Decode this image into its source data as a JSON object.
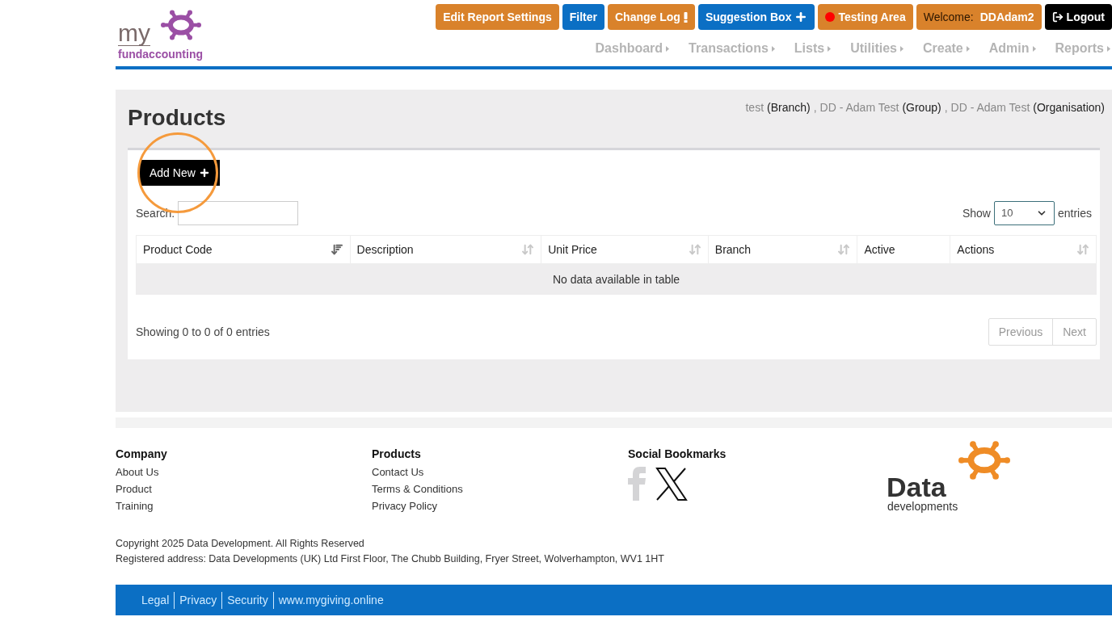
{
  "logo": {
    "prefix": "my",
    "name": "fundaccounting"
  },
  "top_buttons": [
    {
      "label": "Edit Report Settings",
      "color": "#d9822b",
      "kind": "plain"
    },
    {
      "label": "Filter",
      "color": "#0b6fc4",
      "kind": "plain"
    },
    {
      "label": "Change Log",
      "color": "#d9822b",
      "kind": "alert"
    },
    {
      "label": "Suggestion Box",
      "color": "#0b6fc4",
      "kind": "add"
    },
    {
      "label": "Testing Area",
      "color": "#d9822b",
      "kind": "status"
    },
    {
      "label": "Welcome:",
      "user": "DDAdam2",
      "color": "#d9822b",
      "kind": "plain"
    },
    {
      "label": "Logout",
      "color": "#000000",
      "kind": "exit"
    }
  ],
  "nav": [
    "Dashboard",
    "Transactions",
    "Lists",
    "Utilities",
    "Create",
    "Admin",
    "Reports"
  ],
  "page_title": "Products",
  "context": [
    {
      "name": "test",
      "type": "(Branch)",
      "separator": ","
    },
    {
      "name": "DD - Adam Test",
      "type": "(Group)",
      "separator": ","
    },
    {
      "name": "DD - Adam Test",
      "type": "(Organisation)"
    }
  ],
  "add_button": {
    "label": "Add New",
    "highlighted": true
  },
  "search": {
    "label": "Search:"
  },
  "length": {
    "before": "Show",
    "value": "10",
    "after": "entries"
  },
  "table": {
    "columns": [
      {
        "label": "Product Code",
        "kind": "sorted"
      },
      {
        "label": "Description",
        "kind": "sortable"
      },
      {
        "label": "Unit Price",
        "kind": "sortable"
      },
      {
        "label": "Branch",
        "kind": "sortable"
      },
      {
        "label": "Active",
        "kind": "fixed"
      },
      {
        "label": "Actions",
        "kind": "sortable"
      }
    ],
    "empty": "No data available in table"
  },
  "info": "Showing 0 to 0 of 0 entries",
  "pagination": [
    {
      "label": "Previous",
      "disabled": true
    },
    {
      "label": "Next",
      "disabled": true
    }
  ],
  "footer": {
    "columns": [
      {
        "title": "Company",
        "links": [
          "About Us",
          "Product",
          "Training"
        ]
      },
      {
        "title": "Products",
        "links": [
          "Contact Us",
          "Terms & Conditions",
          "Privacy Policy"
        ]
      }
    ],
    "social_title": "Social Bookmarks",
    "brand": {
      "name": "Data",
      "sub": "developments"
    },
    "copyright": "Copyright 2025 Data Development. All Rights Reserved",
    "address": "Registered address: Data Developments (UK) Ltd First Floor, The Chubb Building, Fryer Street, Wolverhampton, WV1 1HT",
    "bottom_links": [
      "Legal",
      "Privacy",
      "Security",
      "www.mygiving.online"
    ]
  }
}
